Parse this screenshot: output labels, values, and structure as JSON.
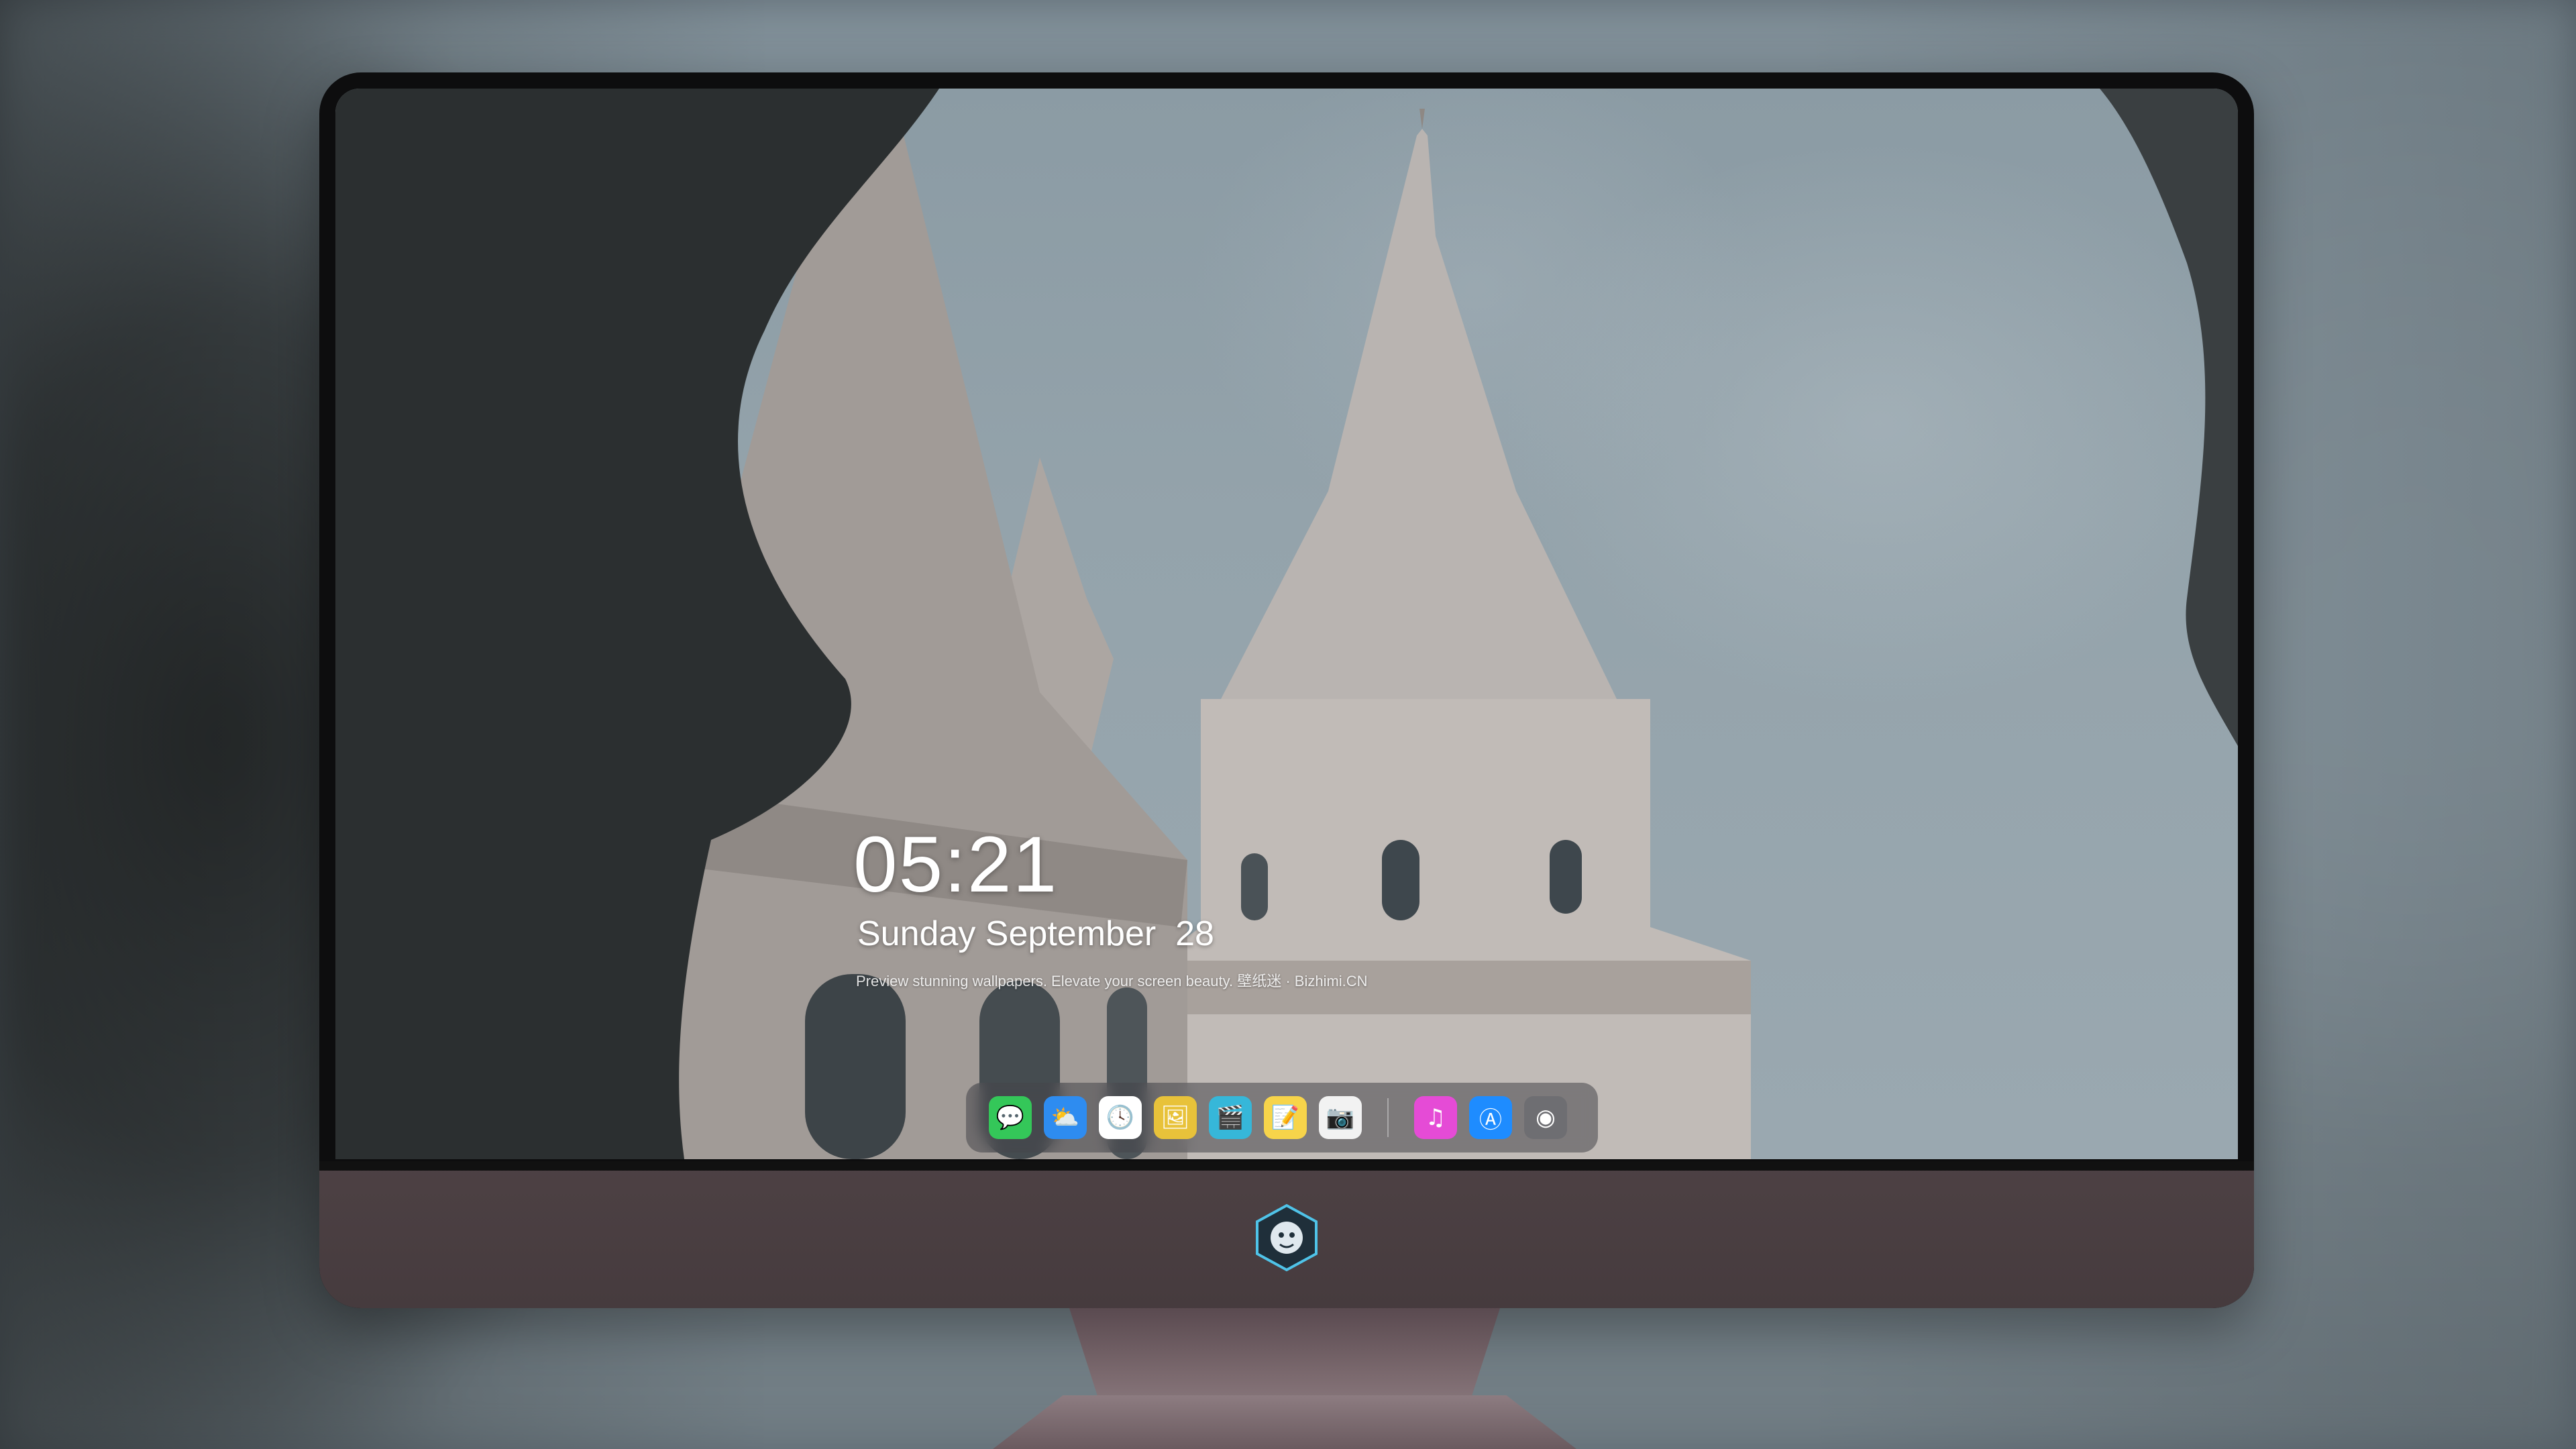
{
  "lockscreen": {
    "time": "05:21",
    "date": "Sunday September  28",
    "tagline": "Preview stunning wallpapers. Elevate your screen beauty. 壁纸迷 · Bizhimi.CN"
  },
  "dock": {
    "apps": [
      {
        "name": "messages-icon",
        "glyph": "💬",
        "color": "#34c759"
      },
      {
        "name": "weather-icon",
        "glyph": "⛅",
        "color": "#2e8cf0"
      },
      {
        "name": "clock-icon",
        "glyph": "🕓",
        "color": "#ffffff"
      },
      {
        "name": "preview-icon",
        "glyph": "🖼",
        "color": "#e8c23a"
      },
      {
        "name": "clips-icon",
        "glyph": "🎬",
        "color": "#36b7d9"
      },
      {
        "name": "notes-icon",
        "glyph": "📝",
        "color": "#f7d44a"
      },
      {
        "name": "photo-booth-icon",
        "glyph": "📷",
        "color": "#f2f2f2"
      },
      {
        "name": "music-icon",
        "glyph": "♫",
        "color": "#e54bd6"
      },
      {
        "name": "app-store-icon",
        "glyph": "Ⓐ",
        "color": "#1e8cff"
      },
      {
        "name": "camera-icon",
        "glyph": "◉",
        "color": "#6e6e72"
      }
    ]
  },
  "colors": {
    "monitor_bezel": "#0d0d0e",
    "monitor_chin": "#4a3e41",
    "sky": "#94a3ab"
  }
}
